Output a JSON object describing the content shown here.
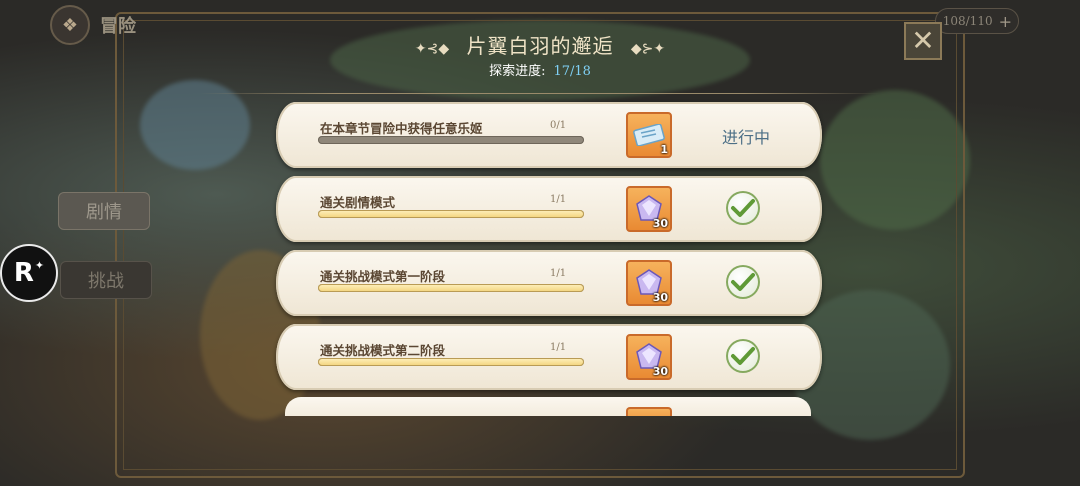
{
  "header": {
    "app_title": "冒险",
    "stamina": "108/110",
    "title": "片翼白羽的邂逅",
    "progress_label": "探索进度:",
    "progress_value": "17/18"
  },
  "side_tabs": [
    "剧情",
    "挑战"
  ],
  "badge": "R",
  "tasks": [
    {
      "name": "在本章节冒险中获得任意乐姬",
      "progress": "0/1",
      "fraction": 0,
      "reward": "ticket-icon",
      "reward_qty": "1",
      "status": "进行中"
    },
    {
      "name": "通关剧情模式",
      "progress": "1/1",
      "fraction": 1,
      "reward": "gem-icon",
      "reward_qty": "30",
      "status": "completed"
    },
    {
      "name": "通关挑战模式第一阶段",
      "progress": "1/1",
      "fraction": 1,
      "reward": "gem-icon",
      "reward_qty": "30",
      "status": "completed"
    },
    {
      "name": "通关挑战模式第二阶段",
      "progress": "1/1",
      "fraction": 1,
      "reward": "gem-icon",
      "reward_qty": "30",
      "status": "completed"
    }
  ],
  "colors": {
    "accent_progress": "#7fd0f5",
    "status_text": "#4c6f86",
    "reward_bg": "#e98a33"
  }
}
